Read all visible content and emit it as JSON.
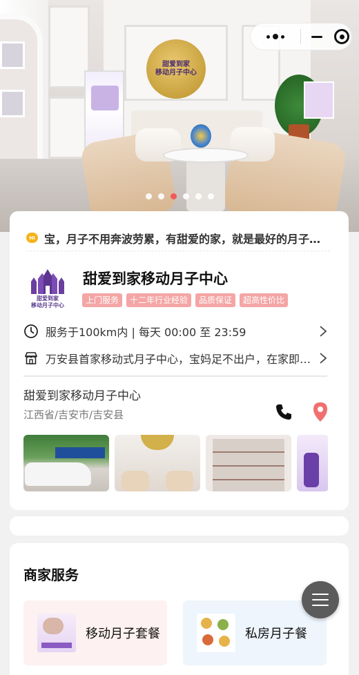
{
  "capsule": {
    "more_icon": "more-dots-icon",
    "minimize_icon": "minimize-icon",
    "close_icon": "target-close-icon"
  },
  "banner": {
    "slide_count": 6,
    "active_index": 2,
    "logo_text_line1": "甜爱到家",
    "logo_text_line2": "移动月子中心"
  },
  "notice": {
    "icon": "hi-chat-icon",
    "icon_text": "HI",
    "text": "宝，月子不用奔波劳累，有甜爱的家，就是最好的月子中心"
  },
  "shop": {
    "logo_line1": "甜爱到家",
    "logo_line2": "移动月子中心",
    "name": "甜爱到家移动月子中心",
    "tags": [
      "上门服务",
      "十二年行业经验",
      "品质保证",
      "超高性价比"
    ],
    "service_hours": "服务于100km内 | 每天 00:00 至 23:59",
    "intro": "万安县首家移动式月子中心，宝妈足不出户，在家即可享受专业月子服务",
    "tag_color": "#f4a5a5"
  },
  "address": {
    "name": "甜爱到家移动月子中心",
    "region": "江西省/吉安市/吉安县",
    "phone_icon": "phone-icon",
    "map_icon": "map-pin-icon",
    "accent": "#f07070"
  },
  "gallery": {
    "count": 4
  },
  "services": {
    "title": "商家服务",
    "items": [
      {
        "label": "移动月子套餐"
      },
      {
        "label": "私房月子餐"
      }
    ]
  },
  "floating": {
    "icon": "menu-icon"
  }
}
